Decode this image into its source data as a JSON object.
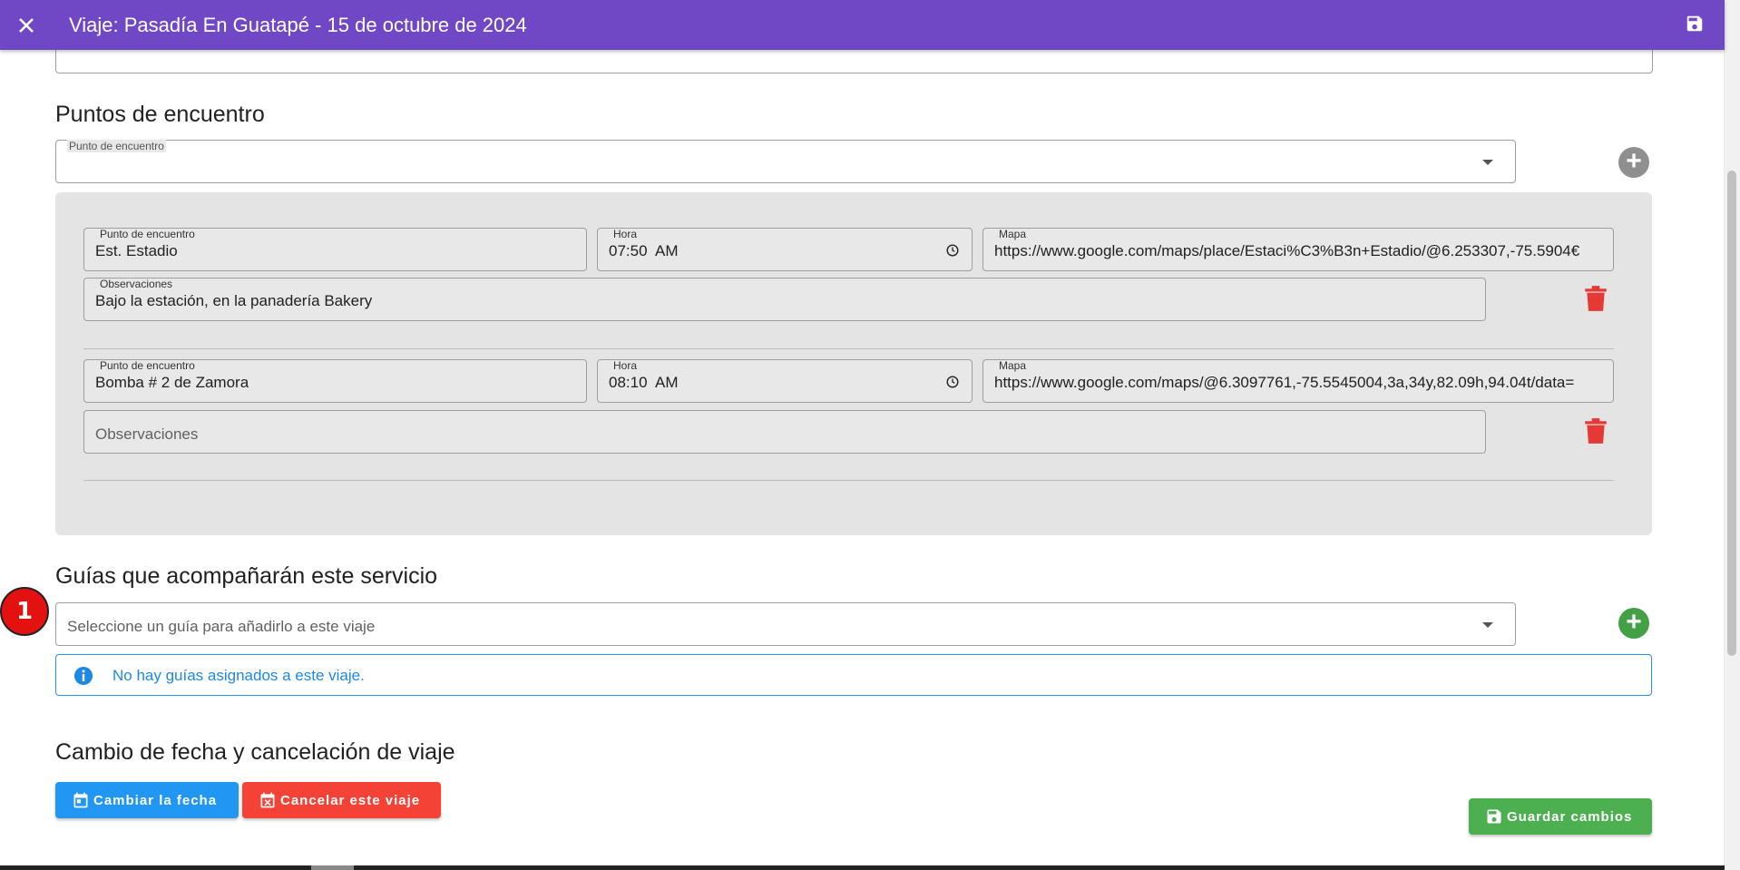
{
  "appbar": {
    "title": "Viaje: Pasadía En Guatapé - 15 de octubre de 2024",
    "close_icon": "close-icon",
    "save_icon": "floppy-disk-icon",
    "color": "#7048c6"
  },
  "meeting_points": {
    "heading": "Puntos de encuentro",
    "select_label": "Punto de encuentro",
    "entries": [
      {
        "point_label": "Punto de encuentro",
        "point_value": "Est. Estadio",
        "time_label": "Hora",
        "time_value": "07:50  AM",
        "map_label": "Mapa",
        "map_value": "https://www.google.com/maps/place/Estaci%C3%B3n+Estadio/@6.253307,-75.5904€",
        "obs_label": "Observaciones",
        "obs_value": "Bajo la estación, en la panadería Bakery"
      },
      {
        "point_label": "Punto de encuentro",
        "point_value": "Bomba # 2 de Zamora",
        "time_label": "Hora",
        "time_value": "08:10  AM",
        "map_label": "Mapa",
        "map_value": "https://www.google.com/maps/@6.3097761,-75.5545004,3a,34y,82.09h,94.04t/data=",
        "obs_placeholder": "Observaciones"
      }
    ]
  },
  "guides": {
    "heading": "Guías que acompañarán este servicio",
    "select_placeholder": "Seleccione un guía para añadirlo a este viaje",
    "alert_text": "No hay guías asignados a este viaje."
  },
  "date_change": {
    "heading": "Cambio de fecha y cancelación de viaje",
    "change_date_label": "Cambiar la fecha",
    "cancel_label": "Cancelar este viaje"
  },
  "footer": {
    "save_label": "Guardar cambios"
  },
  "marker": {
    "label": "1"
  },
  "colors": {
    "primary": "#7048c6",
    "blue": "#2196f3",
    "red": "#f44336",
    "green": "#4caf50",
    "danger_icon": "#e53935"
  }
}
